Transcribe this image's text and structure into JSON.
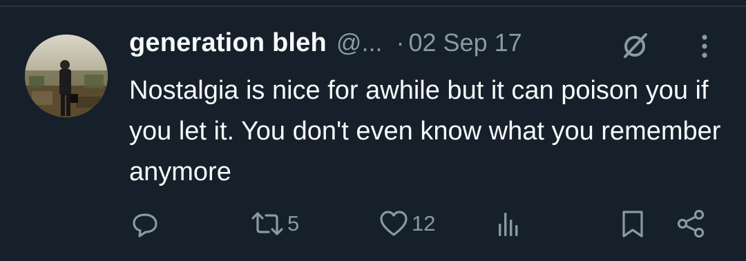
{
  "tweet": {
    "display_name": "generation bleh",
    "handle": "@...",
    "separator": "·",
    "date": "02 Sep 17",
    "text": "Nostalgia is nice for awhile but it can poison you if you let it. You don't even know what you remember anymore",
    "icons": {
      "grok": "grok-slash-icon",
      "more": "vertical-dots-icon"
    }
  },
  "actions": {
    "reply": {
      "icon": "reply-icon"
    },
    "repost": {
      "icon": "repost-icon",
      "count": "5"
    },
    "like": {
      "icon": "heart-icon",
      "count": "12"
    },
    "views": {
      "icon": "views-bar-icon"
    },
    "bookmark": {
      "icon": "bookmark-icon"
    },
    "share": {
      "icon": "share-icon"
    }
  },
  "colors": {
    "background": "#15202b",
    "primary_text": "#f7f9f9",
    "secondary_text": "#8b98a5"
  }
}
